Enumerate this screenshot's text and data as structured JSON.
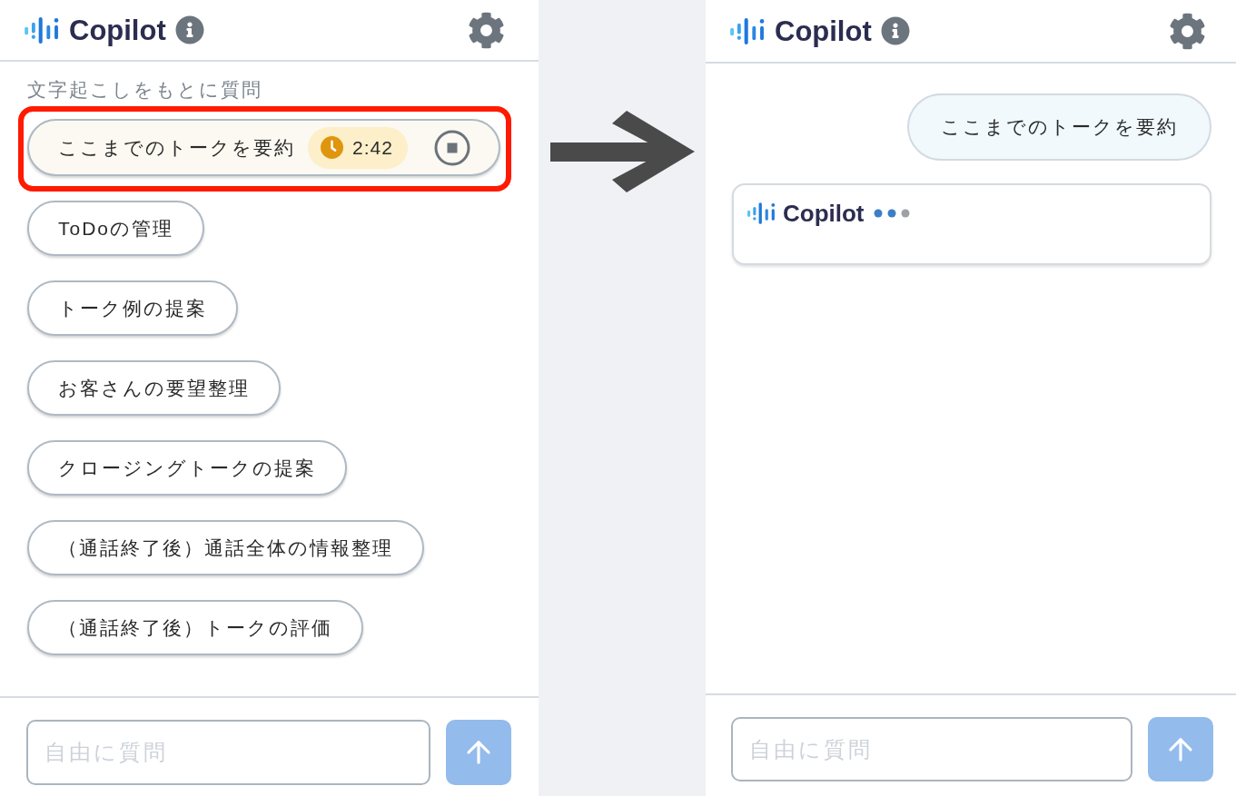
{
  "left_panel": {
    "header": {
      "title": "Copilot"
    },
    "section_label": "文字起こしをもとに質問",
    "suggestions": [
      {
        "kind": "running",
        "label": "ここまでのトークを要約",
        "timer": "2:42",
        "highlighted": true
      },
      {
        "kind": "plain",
        "label": "ToDoの管理",
        "highlighted": false
      },
      {
        "kind": "plain",
        "label": "トーク例の提案",
        "highlighted": false
      },
      {
        "kind": "plain",
        "label": "お客さんの要望整理",
        "highlighted": false
      },
      {
        "kind": "plain",
        "label": "クロージングトークの提案",
        "highlighted": false
      },
      {
        "kind": "plain",
        "label": "（通話終了後）通話全体の情報整理",
        "highlighted": false
      },
      {
        "kind": "plain",
        "label": "（通話終了後）トークの評価",
        "highlighted": false
      }
    ],
    "input": {
      "placeholder": "自由に質問"
    }
  },
  "right_panel": {
    "header": {
      "title": "Copilot"
    },
    "messages": [
      {
        "kind": "user",
        "text": "ここまでのトークを要約"
      },
      {
        "kind": "assistant",
        "sender": "Copilot",
        "typing": true
      }
    ],
    "input": {
      "placeholder": "自由に質問"
    }
  }
}
